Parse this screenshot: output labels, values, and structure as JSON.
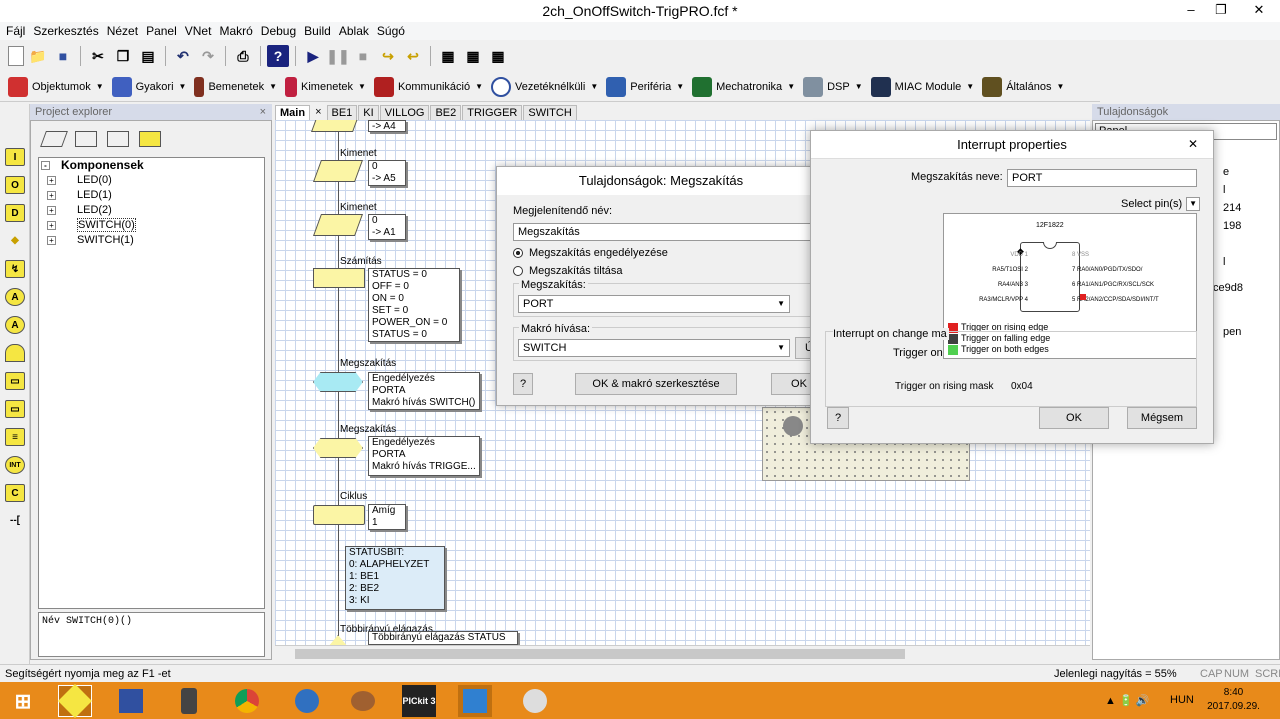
{
  "window": {
    "title": "2ch_OnOffSwitch-TrigPRO.fcf *"
  },
  "menu": [
    "Fájl",
    "Szerkesztés",
    "Nézet",
    "Panel",
    "VNet",
    "Makró",
    "Debug",
    "Build",
    "Ablak",
    "Súgó"
  ],
  "categories": [
    "Objektumok",
    "Gyakori",
    "Bemenetek",
    "Kimenetek",
    "Kommunikáció",
    "Vezetéknélküli",
    "Periféria",
    "Mechatronika",
    "DSP",
    "MIAC Module",
    "Általános"
  ],
  "project_explorer": {
    "title": "Project explorer",
    "root": "Komponensek",
    "items": [
      "LED(0)",
      "LED(1)",
      "LED(2)",
      "SWITCH(0)",
      "SWITCH(1)"
    ],
    "name_field": "Név SWITCH(0)()"
  },
  "tabs": [
    "Main",
    "BE1",
    "KI",
    "VILLOG",
    "BE2",
    "TRIGGER",
    "SWITCH"
  ],
  "flow": {
    "top_out": "-> A4",
    "out1_label": "Kimenet",
    "out1_v": "0",
    "out1_p": "-> A5",
    "out2_label": "Kimenet",
    "out2_v": "0",
    "out2_p": "-> A1",
    "calc_label": "Számítás",
    "calc_lines": [
      "STATUS = 0",
      "OFF = 0",
      "ON = 0",
      "SET = 0",
      "POWER_ON = 0",
      "STATUS = 0"
    ],
    "int1_label": "Megszakítás",
    "int1_lines": [
      "Engedélyezés",
      "PORTA",
      "Makró hívás SWITCH()"
    ],
    "int2_label": "Megszakítás",
    "int2_lines": [
      "Engedélyezés",
      "PORTA",
      "Makró hívás TRIGGE..."
    ],
    "loop_label": "Ciklus",
    "loop_lines": [
      "Amíg",
      "1"
    ],
    "note_lines": [
      "STATUSBIT:",
      "0: ALAPHELYZET",
      "1: BE1",
      "2: BE2",
      "3: KI"
    ],
    "switch_label": "Többirányú elágazás",
    "switch_text": "Többirányú elágazás STATUS"
  },
  "props_panel": {
    "title": "Tulajdonságok",
    "dropdown": "Panel",
    "rows": [
      "e",
      "l",
      "214",
      "198",
      "l",
      "ce9d8",
      "",
      "pen"
    ]
  },
  "dialog_props": {
    "title": "Tulajdonságok: Megszakítás",
    "display_name_label": "Megjelenítendő név:",
    "display_name_value": "Megszakítás",
    "radio_enable": "Megszakítás engedélyezése",
    "radio_disable": "Megszakítás tiltása",
    "interrupt_group": "Megszakítás:",
    "interrupt_value": "PORT",
    "macro_group": "Makró hívása:",
    "macro_value": "SWITCH",
    "help": "?",
    "ok_edit": "OK & makró szerkesztése",
    "ok": "OK",
    "u": "Ú"
  },
  "dialog_interrupt": {
    "title": "Interrupt properties",
    "name_label": "Megszakítás neve:",
    "name_value": "PORT",
    "select_pins": "Select pin(s)",
    "chip": "12F1822",
    "pins_left": [
      "VDD",
      "RA5/T1OSI",
      "RA4/AN3",
      "RA3/MCLR/VPP"
    ],
    "pins_right": [
      "VSS",
      "RA0/AN0/PGD/TX/SDO/",
      "RA1/AN1/PGC/RX/SCL/SCK",
      "RA2/AN2/CCP/SDA/SDI/INT/T"
    ],
    "nums_left": [
      "1",
      "2",
      "3",
      "4"
    ],
    "nums_right": [
      "8",
      "7",
      "6",
      "5"
    ],
    "ioc_label": "Interrupt on change ma",
    "trigger_label": "Trigger on",
    "legend": [
      "Trigger on rising edge",
      "Trigger on falling edge",
      "Trigger on both edges"
    ],
    "legend_colors": [
      "#e02020",
      "#404040",
      "#50d050"
    ],
    "mask_label": "Trigger on rising mask",
    "mask_value": "0x04",
    "help": "?",
    "ok": "OK",
    "cancel": "Mégsem"
  },
  "status": {
    "help_text": "Segítségért nyomja meg az F1 -et",
    "zoom": "Jelenlegi nagyítás = 55%",
    "caps": "CAP",
    "num": "NUM",
    "scrl": "SCRL"
  },
  "taskbar": {
    "lang": "HUN",
    "time": "8:40",
    "date": "2017.09.29.",
    "pickit": "PICkit 3"
  }
}
